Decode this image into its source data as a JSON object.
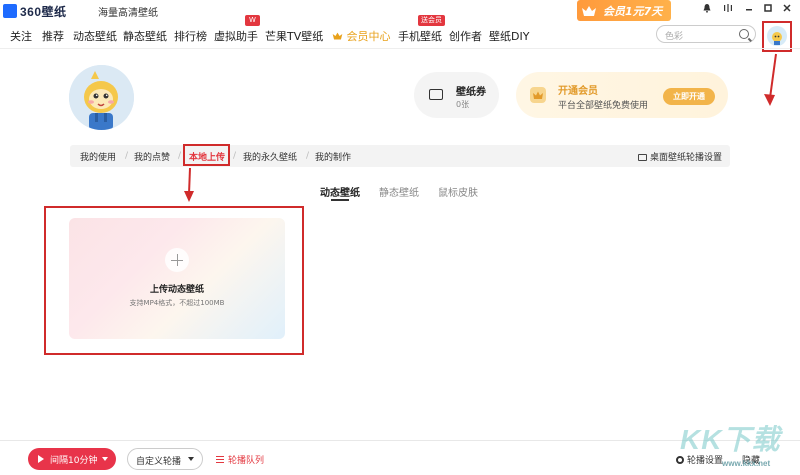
{
  "app": {
    "logo_text": "360壁纸",
    "slogan": "海量高清壁纸",
    "promo": "会员1元7天"
  },
  "window_controls": [
    "bell",
    "minimize",
    "maximize",
    "close"
  ],
  "nav": {
    "items": [
      {
        "label": "关注"
      },
      {
        "label": "推荐"
      },
      {
        "label": "动态壁纸"
      },
      {
        "label": "静态壁纸"
      },
      {
        "label": "排行榜"
      },
      {
        "label": "虚拟助手",
        "badge": "W"
      },
      {
        "label": "芒果TV壁纸"
      },
      {
        "label": "会员中心",
        "vip": true
      },
      {
        "label": "手机壁纸",
        "badge": "送会员"
      },
      {
        "label": "创作者"
      },
      {
        "label": "壁纸DIY"
      }
    ],
    "search_placeholder": "色彩"
  },
  "profile": {
    "voucher_title": "壁纸券",
    "voucher_count": "0张",
    "vip_title": "开通会员",
    "vip_desc": "平台全部壁纸免费使用",
    "vip_button": "立即开通"
  },
  "tabs": {
    "items": [
      "我的使用",
      "我的点赞",
      "本地上传",
      "我的永久壁纸",
      "我的制作"
    ],
    "active": "本地上传",
    "carousel_setting": "桌面壁纸轮播设置"
  },
  "subtabs": {
    "items": [
      "动态壁纸",
      "静态壁纸",
      "鼠标皮肤"
    ],
    "active": "动态壁纸"
  },
  "upload": {
    "title": "上传动态壁纸",
    "hint": "支持MP4格式，不超过100MB"
  },
  "footer": {
    "interval": "间隔10分钟",
    "custom": "自定义轮播",
    "queue": "轮播队列",
    "settings": "轮播设置",
    "hide": "隐藏"
  },
  "watermark": {
    "text": "KK下载",
    "url": "www.kkx.net"
  },
  "colors": {
    "accent_red": "#e3373f",
    "vip_gold": "#e29a2a",
    "annotation_red": "#d02b2b"
  }
}
